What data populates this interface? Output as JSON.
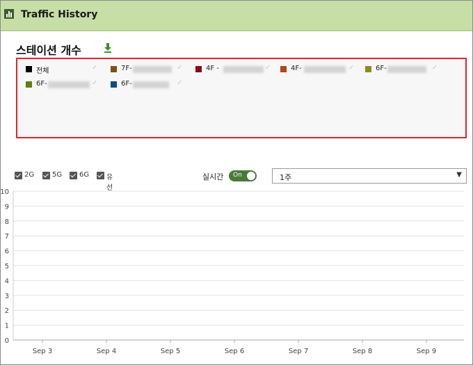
{
  "header": {
    "title": "Traffic History",
    "icon": "bar-chart-icon"
  },
  "section": {
    "title": "스테이션 개수",
    "download_icon": "download-icon"
  },
  "legend": [
    {
      "label": "전체",
      "color": "#000000",
      "blurred": false
    },
    {
      "label": "7F-",
      "color": "#7a5218",
      "blurred": true
    },
    {
      "label": "4F -",
      "color": "#8b0a16",
      "blurred": true
    },
    {
      "label": "4F-",
      "color": "#b04a12",
      "blurred": true
    },
    {
      "label": "6F-",
      "color": "#8e8a1c",
      "blurred": true
    },
    {
      "label": "6F-",
      "color": "#5f7d12",
      "blurred": true
    },
    {
      "label": "6F-",
      "color": "#0d4a8a",
      "blurred": true
    }
  ],
  "filters": [
    {
      "label": "2G",
      "checked": true
    },
    {
      "label": "5G",
      "checked": true
    },
    {
      "label": "6G",
      "checked": true
    },
    {
      "label": "유선",
      "checked": true
    }
  ],
  "realtime": {
    "label": "실시간",
    "toggle": "On",
    "on": true
  },
  "period_select": {
    "value": "1주"
  },
  "chart_data": {
    "type": "line",
    "categories": [
      "Sep 3",
      "Sep 4",
      "Sep 5",
      "Sep 6",
      "Sep 7",
      "Sep 8",
      "Sep 9"
    ],
    "yticks": [
      "0",
      "1",
      "2",
      "3",
      "4",
      "5",
      "6",
      "7",
      "8",
      "9",
      "10"
    ],
    "ylim": [
      0,
      10
    ],
    "grid": true,
    "series": []
  }
}
